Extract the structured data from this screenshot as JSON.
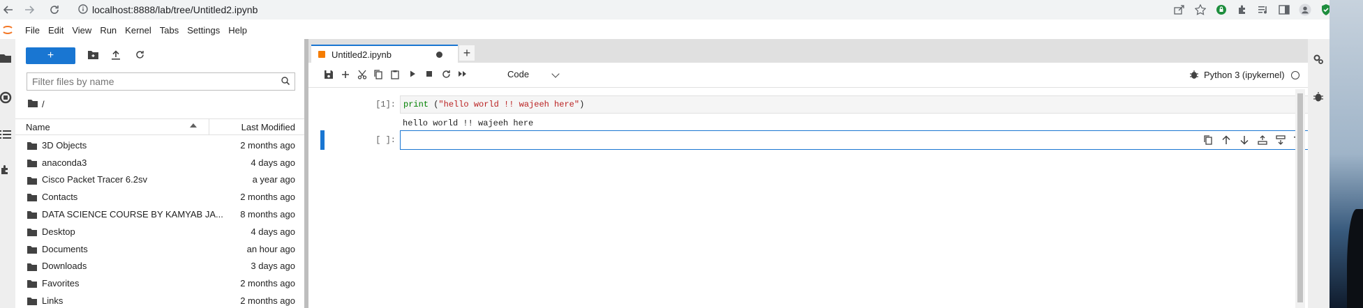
{
  "browser": {
    "url": "localhost:8888/lab/tree/Untitled2.ipynb",
    "icons": [
      "back-icon",
      "forward-icon",
      "reload-icon",
      "info-icon",
      "share-icon",
      "star-icon",
      "shield-icon",
      "extensions-icon",
      "media-icon",
      "sidebar-icon",
      "profile-icon",
      "security-icon",
      "more-icon"
    ]
  },
  "menu": {
    "items": [
      "File",
      "Edit",
      "View",
      "Run",
      "Kernel",
      "Tabs",
      "Settings",
      "Help"
    ]
  },
  "file_browser": {
    "new_label": "+",
    "filter_placeholder": "Filter files by name",
    "path": "/",
    "columns": {
      "name": "Name",
      "modified": "Last Modified"
    },
    "files": [
      {
        "name": "3D Objects",
        "modified": "2 months ago"
      },
      {
        "name": "anaconda3",
        "modified": "4 days ago"
      },
      {
        "name": "Cisco Packet Tracer 6.2sv",
        "modified": "a year ago"
      },
      {
        "name": "Contacts",
        "modified": "2 months ago"
      },
      {
        "name": "DATA SCIENCE COURSE BY KAMYAB JA...",
        "modified": "8 months ago"
      },
      {
        "name": "Desktop",
        "modified": "4 days ago"
      },
      {
        "name": "Documents",
        "modified": "an hour ago"
      },
      {
        "name": "Downloads",
        "modified": "3 days ago"
      },
      {
        "name": "Favorites",
        "modified": "2 months ago"
      },
      {
        "name": "Links",
        "modified": "2 months ago"
      }
    ]
  },
  "notebook": {
    "tab_title": "Untitled2.ipynb",
    "add_tab_label": "+",
    "cell_type": "Code",
    "kernel": "Python 3 (ipykernel)",
    "cells": [
      {
        "prompt": "[1]:",
        "code_fn": "print",
        "code_rest": " (",
        "code_str": "\"hello world !! wajeeh here\"",
        "code_end": ")",
        "output": "hello world !! wajeeh here"
      },
      {
        "prompt": "[ ]:"
      }
    ]
  },
  "colors": {
    "accent": "#1976d2",
    "tab_icon": "#f57c00"
  }
}
